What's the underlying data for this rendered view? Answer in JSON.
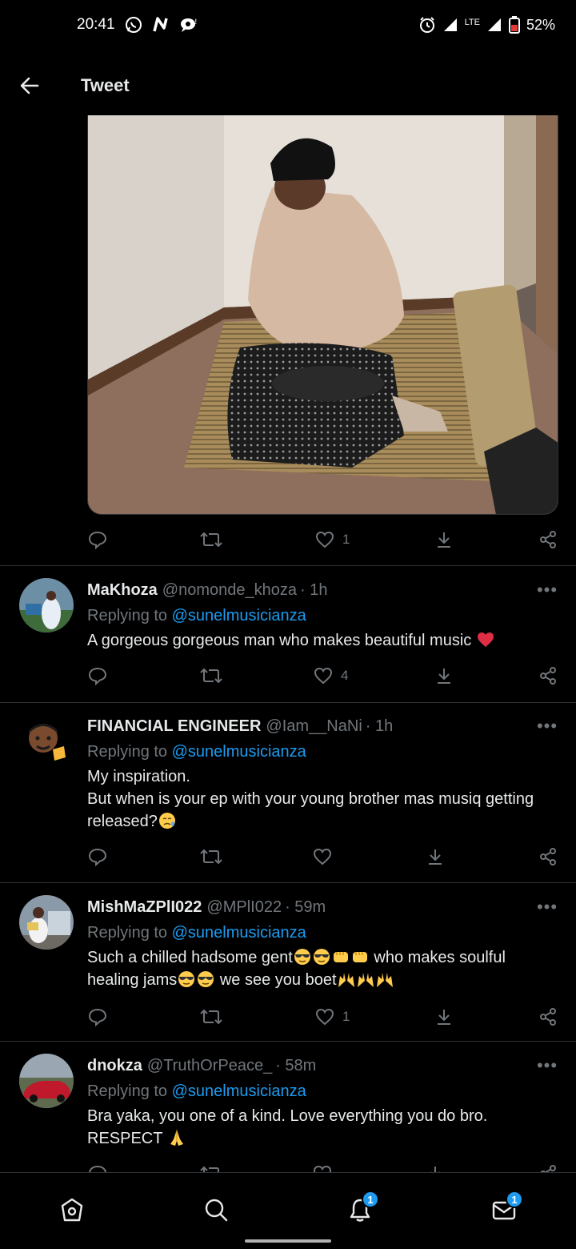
{
  "status_bar": {
    "time": "20:41",
    "network": "LTE",
    "battery": "52%"
  },
  "header": {
    "title": "Tweet"
  },
  "main_tweet": {
    "image_alt": "woman in headscarf and blanket kneeling on a mat",
    "actions": {
      "reply": "",
      "retweet": "",
      "like": "1"
    }
  },
  "replies": [
    {
      "name": "MaKhoza",
      "handle": "@nomonde_khoza",
      "time": "· 1h",
      "replying_label": "Replying to",
      "replying_to": "@sunelmusicianza",
      "lines": [
        "A gorgeous gorgeous man who makes beautiful music"
      ],
      "likes": "4"
    },
    {
      "name": "FINANCIAL ENGINEER",
      "handle": "@Iam__NaNi",
      "time": "· 1h",
      "replying_label": "Replying to",
      "replying_to": "@sunelmusicianza",
      "lines": [
        "My inspiration.",
        "But when is your ep with your young brother mas musiq getting",
        "released?"
      ],
      "likes": ""
    },
    {
      "name": "MishMaZPlI022",
      "handle": "@MPlI022",
      "time": "· 59m",
      "replying_label": "Replying to",
      "replying_to": "@sunelmusicianza",
      "lines": [
        "Such a chilled hadsome gent",
        "who makes soulful",
        "healing jams",
        "we see you boet"
      ],
      "likes": "1"
    },
    {
      "name": "dnokza",
      "handle": "@TruthOrPeace_",
      "time": "· 58m",
      "replying_label": "Replying to",
      "replying_to": "@sunelmusicianza",
      "lines": [
        "Bra yaka, you one of a kind. Love everything you do bro.",
        "RESPECT"
      ],
      "likes": ""
    }
  ],
  "bottom_nav": {
    "notifications_badge": "1",
    "messages_badge": "1"
  },
  "colors": {
    "background": "#000000",
    "text": "#e7e9ea",
    "muted": "#71767b",
    "link": "#1d9bf0",
    "divider": "#2f3336"
  }
}
